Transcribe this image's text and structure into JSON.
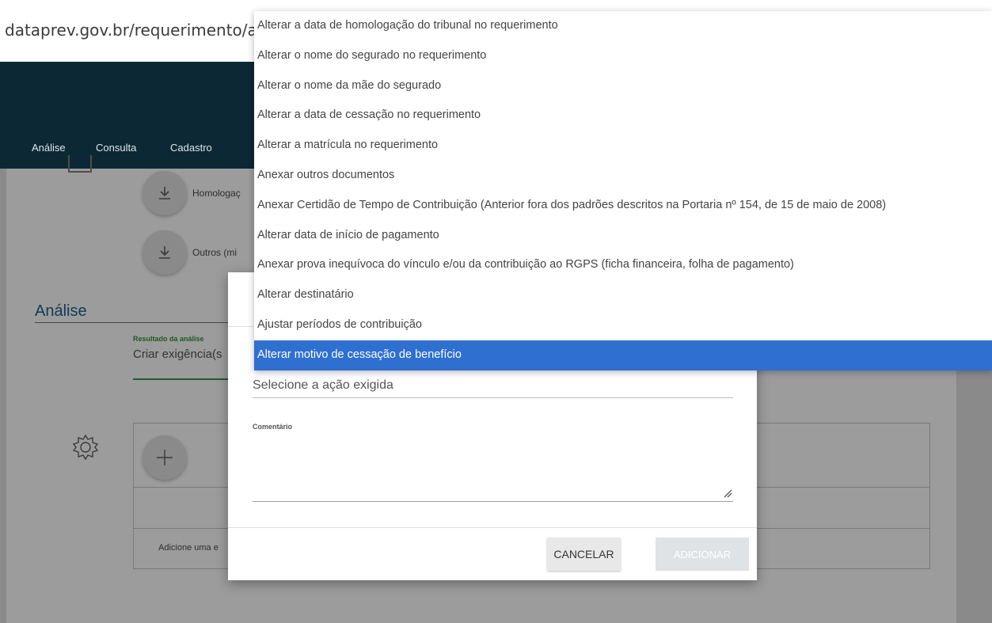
{
  "browser": {
    "url": "dataprev.gov.br/requerimento/a"
  },
  "nav": {
    "items": [
      "Análise",
      "Consulta",
      "Cadastro"
    ]
  },
  "documents": [
    {
      "label": "Homologaç"
    },
    {
      "label": "Outros (mi"
    }
  ],
  "analise": {
    "title": "Análise",
    "result_label": "Resultado da análise",
    "result_value": "Criar exigência(s"
  },
  "table": {
    "empty_message": "Adicione uma e"
  },
  "modal": {
    "select_placeholder": "Selecione a ação exigida",
    "comment_label": "Comentário",
    "cancel_label": "CANCELAR",
    "add_label": "ADICIONAR"
  },
  "dropdown": {
    "options": [
      "Alterar a data de homologação do tribunal no requerimento",
      "Alterar o nome do segurado no requerimento",
      "Alterar o nome da mãe do segurado",
      "Alterar a data de cessação no requerimento",
      "Alterar a matrícula no requerimento",
      "Anexar outros documentos",
      "Anexar Certidão de Tempo de Contribuição (Anterior fora dos padrões descritos na Portaria nº 154, de 15 de maio de 2008)",
      "Alterar data de início de pagamento",
      "Anexar prova inequívoca do vínculo e/ou da contribuição ao RGPS (ficha financeira, folha de pagamento)",
      "Alterar destinatário",
      "Ajustar períodos de contribuição",
      "Alterar motivo de cessação de benefício"
    ],
    "selected_index": 11
  },
  "colors": {
    "highlight": "#2f6fd0",
    "nav_bg": "#0c2834",
    "title": "#0f3c55",
    "result_green": "#1e5a1e"
  },
  "icons": [
    "doc-icon",
    "download-icon",
    "gear-icon",
    "plus-icon",
    "resize-icon"
  ]
}
